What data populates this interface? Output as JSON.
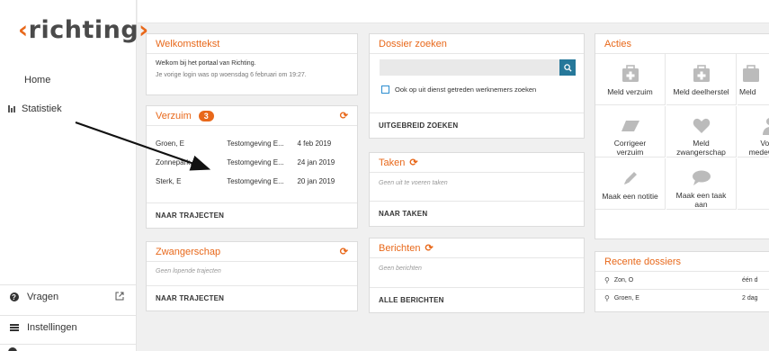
{
  "sidebar": {
    "logo_left": "‹",
    "logo_text": "richting",
    "logo_right": "›",
    "home": "Home",
    "statistiek": "Statistiek",
    "vragen": "Vragen",
    "instellingen": "Instellingen"
  },
  "welkom": {
    "title": "Welkomsttekst",
    "line1": "Welkom bij het portaal van Richting.",
    "line2": "Je vorige login was op woensdag 6 februari om 19:27."
  },
  "verzuim": {
    "title": "Verzuim",
    "count": "3",
    "rows": [
      {
        "name": "Groen, E",
        "env": "Testomgeving E...",
        "date": "4 feb 2019"
      },
      {
        "name": "Zonnepark, U",
        "env": "Testomgeving E...",
        "date": "24 jan 2019"
      },
      {
        "name": "Sterk, E",
        "env": "Testomgeving E...",
        "date": "20 jan 2019"
      }
    ],
    "footer": "NAAR TRAJECTEN"
  },
  "zwangerschap": {
    "title": "Zwangerschap",
    "empty": "Geen lopende trajecten",
    "footer": "NAAR TRAJECTEN"
  },
  "dossier_zoeken": {
    "title": "Dossier zoeken",
    "checkbox_label": "Ook op uit dienst getreden werknemers zoeken",
    "footer": "UITGEBREID ZOEKEN"
  },
  "taken": {
    "title": "Taken",
    "empty": "Geen uit te voeren taken",
    "footer": "NAAR TAKEN"
  },
  "berichten": {
    "title": "Berichten",
    "empty": "Geen berichten",
    "footer": "ALLE BERICHTEN"
  },
  "acties": {
    "title": "Acties",
    "items": [
      {
        "label": "Meld verzuim",
        "icon": "medkit-icon"
      },
      {
        "label": "Meld deelherstel",
        "icon": "medkit-icon"
      },
      {
        "label": "Meld",
        "icon": "medkit-icon"
      },
      {
        "label": "Corrigeer verzuim",
        "icon": "eraser-icon"
      },
      {
        "label": "Meld zwangerschap",
        "icon": "heart-icon"
      },
      {
        "label": "Voe medew",
        "icon": "user-icon"
      },
      {
        "label": "Maak een notitie",
        "icon": "pencil-icon"
      },
      {
        "label": "Maak een taak aan",
        "icon": "speech-bubble-icon"
      }
    ]
  },
  "recente_dossiers": {
    "title": "Recente dossiers",
    "items": [
      {
        "name": "Zon, O",
        "when": "één d"
      },
      {
        "name": "Groen, E",
        "when": "2 dag"
      }
    ]
  },
  "colors": {
    "accent": "#e8681a",
    "search_button": "#26789a",
    "checkbox_border": "#2b8dd0"
  }
}
